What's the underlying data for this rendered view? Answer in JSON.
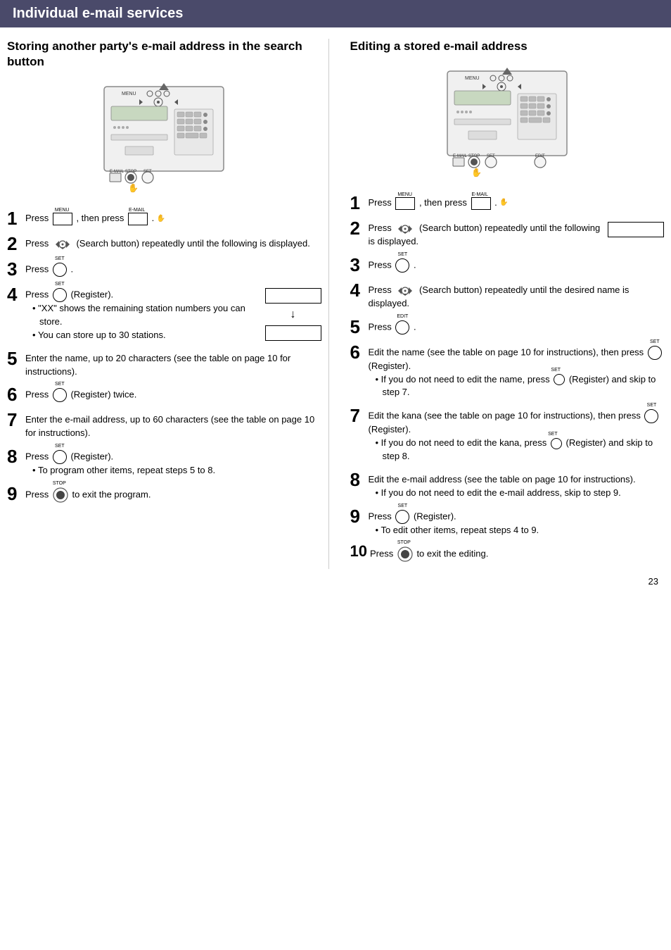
{
  "header": {
    "title": "Individual e-mail services"
  },
  "left": {
    "section_title": "Storing another party's e-mail address in the search button",
    "steps": [
      {
        "num": "1",
        "text": "Press [MENU], then press [E-MAIL].",
        "html_key": "step1_left"
      },
      {
        "num": "2",
        "text": "Press (Search button) repeatedly until the following is displayed.",
        "html_key": "step2_left"
      },
      {
        "num": "3",
        "text": "Press [SET].",
        "html_key": "step3_left"
      },
      {
        "num": "4",
        "text": "Press [SET] (Register).",
        "html_key": "step4_left",
        "bullets": [
          "\"XX\" shows the remaining station numbers you can store.",
          "You can store up to 30 stations."
        ],
        "has_display": true
      },
      {
        "num": "5",
        "text": "Enter the name, up to 20 characters (see the table on page 10 for instructions).",
        "html_key": "step5_left"
      },
      {
        "num": "6",
        "text": "Press [SET] (Register) twice.",
        "html_key": "step6_left"
      },
      {
        "num": "7",
        "text": "Enter the e-mail address, up to 60 characters (see the table on page 10 for instructions).",
        "html_key": "step7_left"
      },
      {
        "num": "8",
        "text": "Press [SET] (Register).",
        "html_key": "step8_left",
        "bullets": [
          "To program other items, repeat steps 5 to 8."
        ]
      },
      {
        "num": "9",
        "text": "Press [STOP] to exit the program.",
        "html_key": "step9_left"
      }
    ]
  },
  "right": {
    "section_title": "Editing a stored e-mail address",
    "steps": [
      {
        "num": "1",
        "text": "Press [MENU], then press [E-MAIL].",
        "html_key": "step1_right"
      },
      {
        "num": "2",
        "text": "Press (Search button) repeatedly until the following is displayed.",
        "html_key": "step2_right",
        "has_display": true
      },
      {
        "num": "3",
        "text": "Press [SET].",
        "html_key": "step3_right"
      },
      {
        "num": "4",
        "text": "Press (Search button) repeatedly until the desired name is displayed.",
        "html_key": "step4_right"
      },
      {
        "num": "5",
        "text": "Press [EDIT].",
        "html_key": "step5_right"
      },
      {
        "num": "6",
        "text": "Edit the name (see the table on page 10 for instructions), then press [SET] (Register).",
        "html_key": "step6_right",
        "bullets": [
          "If you do not need to edit the name, press [SET] (Register) and skip to step 7."
        ]
      },
      {
        "num": "7",
        "text": "Edit the kana (see the table on page 10 for instructions), then press [SET] (Register).",
        "html_key": "step7_right",
        "bullets": [
          "If you do not need to edit the kana, press [SET] (Register) and skip to step 8."
        ]
      },
      {
        "num": "8",
        "text": "Edit the e-mail address (see the table on page 10 for instructions).",
        "html_key": "step8_right",
        "bullets": [
          "If you do not need to edit the e-mail address, skip to step 9."
        ]
      },
      {
        "num": "9",
        "text": "Press [SET] (Register).",
        "html_key": "step9_right",
        "bullets": [
          "To edit other items, repeat steps 4 to 9."
        ]
      },
      {
        "num": "10",
        "text": "Press [STOP] to exit the editing.",
        "html_key": "step10_right"
      }
    ]
  },
  "page_number": "23"
}
